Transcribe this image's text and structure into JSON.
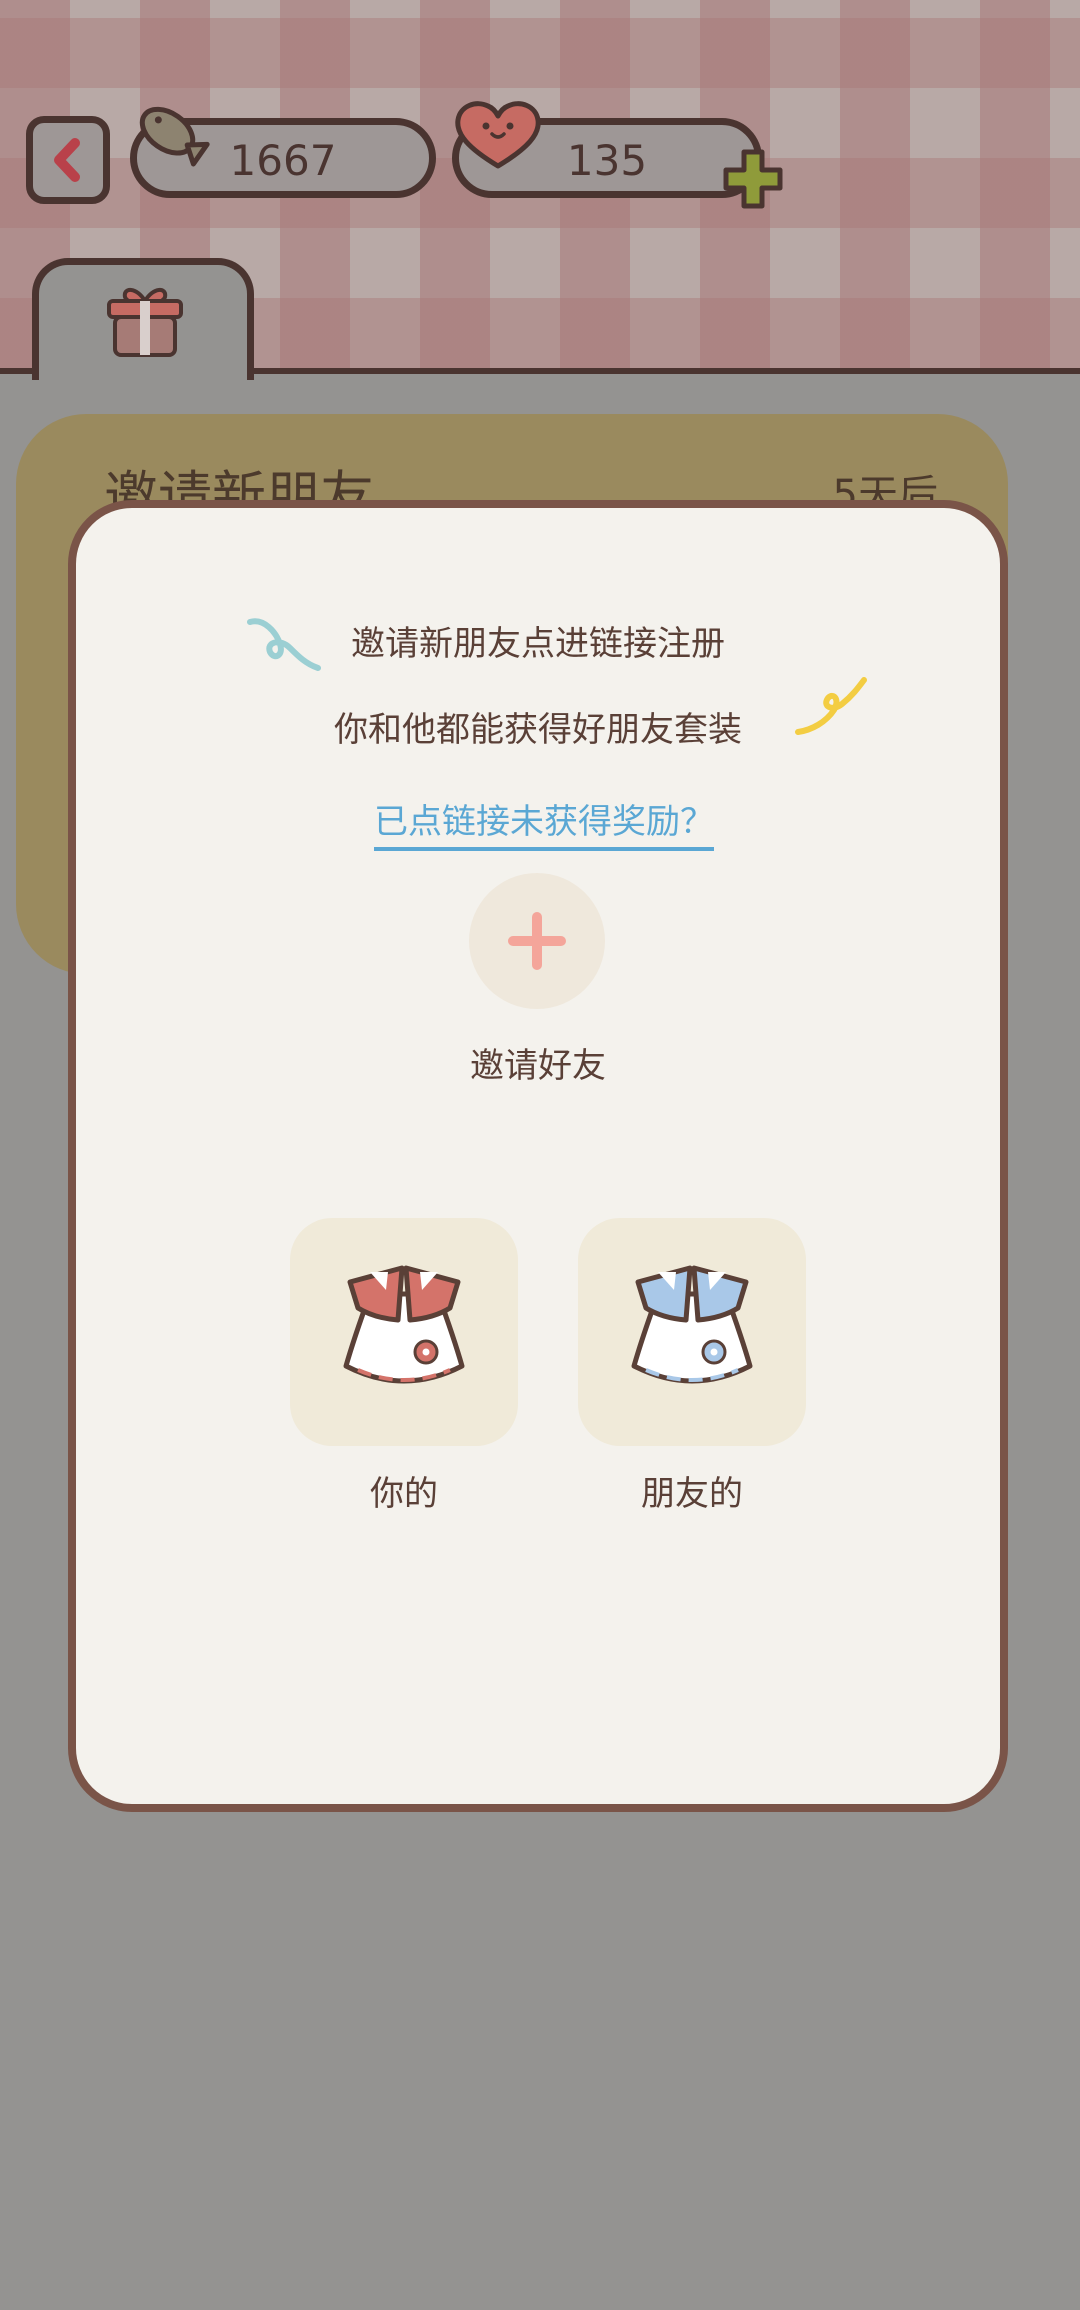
{
  "topbar": {
    "fish_count": "1667",
    "heart_count": "135"
  },
  "back_card": {
    "title": "邀请新朋友",
    "days": "5天后"
  },
  "modal": {
    "line1": "邀请新朋友点进链接注册",
    "line2": "你和他都能获得好朋友套装",
    "help_link": "已点链接未获得奖励？",
    "invite_label": "邀请好友",
    "reward_yours_label": "你的",
    "reward_friend_label": "朋友的"
  },
  "colors": {
    "outline": "#4a3430",
    "modal_border": "#7a5448",
    "link": "#5aa7d4",
    "accent_pink": "#f4a59a",
    "accent_green": "#8f9b3a",
    "reward_red": "#d4736a",
    "reward_blue": "#a9c8e8"
  },
  "icons": [
    "back-chevron-icon",
    "fish-icon",
    "heart-icon",
    "plus-icon",
    "gift-icon",
    "squiggle-icon",
    "dress-icon"
  ]
}
